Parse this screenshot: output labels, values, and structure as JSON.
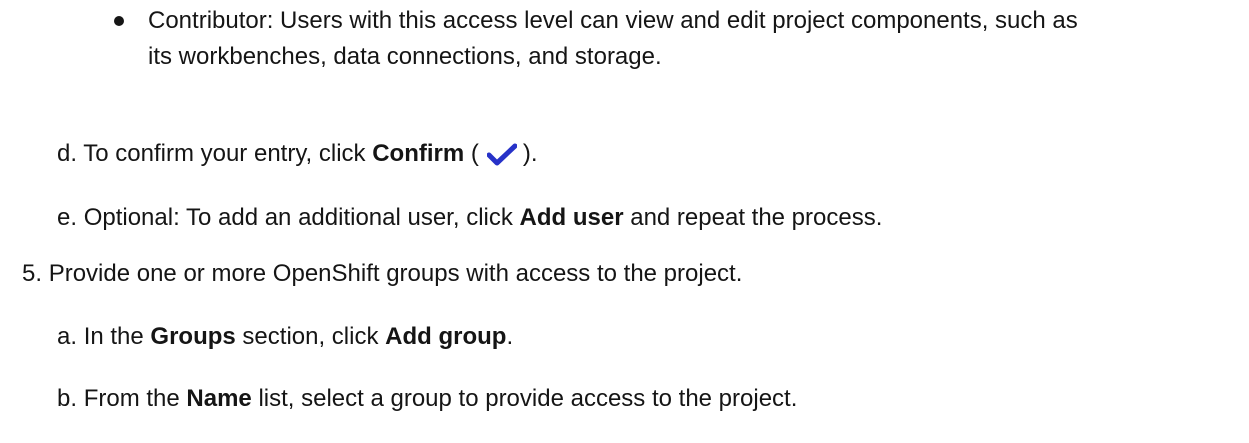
{
  "bullet_item": {
    "line1": "Contributor: Users with this access level can view and edit project components, such as",
    "line2": "its workbenches, data connections, and storage."
  },
  "step_d": {
    "marker": "d.",
    "pre": "To confirm your entry, click",
    "bold": "Confirm",
    "paren_open": "(",
    "icon": "checkmark-icon",
    "paren_close": ").",
    "icon_color": "#2732c8"
  },
  "step_e": {
    "marker": "e.",
    "pre": "Optional: To add an additional user, click",
    "bold": "Add user",
    "post": "and repeat the process."
  },
  "step_5": {
    "marker": "5.",
    "text": "Provide one or more OpenShift groups with access to the project."
  },
  "step_a": {
    "marker": "a.",
    "pre": "In the",
    "bold1": "Groups",
    "mid": "section, click",
    "bold2": "Add group",
    "post": "."
  },
  "step_b": {
    "marker": "b.",
    "pre": "From the",
    "bold": "Name",
    "post": "list, select a group to provide access to the project."
  }
}
